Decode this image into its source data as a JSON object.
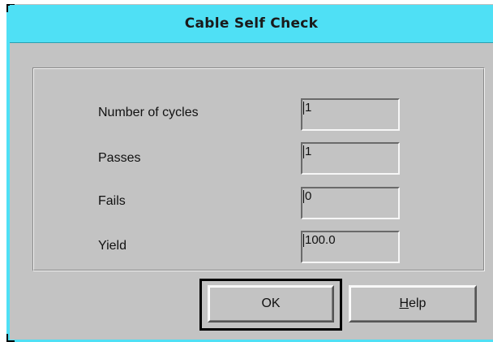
{
  "window": {
    "title": "Cable Self Check"
  },
  "fields": [
    {
      "label": "Number of cycles",
      "value": "1"
    },
    {
      "label": "Passes",
      "value": "1"
    },
    {
      "label": "Fails",
      "value": "0"
    },
    {
      "label": "Yield",
      "value": "100.0"
    }
  ],
  "buttons": {
    "ok_label": "OK",
    "help_mnemonic": "H",
    "help_rest": "elp"
  },
  "colors": {
    "titlebar": "#4fe0f5",
    "background": "#c3c3c3"
  }
}
